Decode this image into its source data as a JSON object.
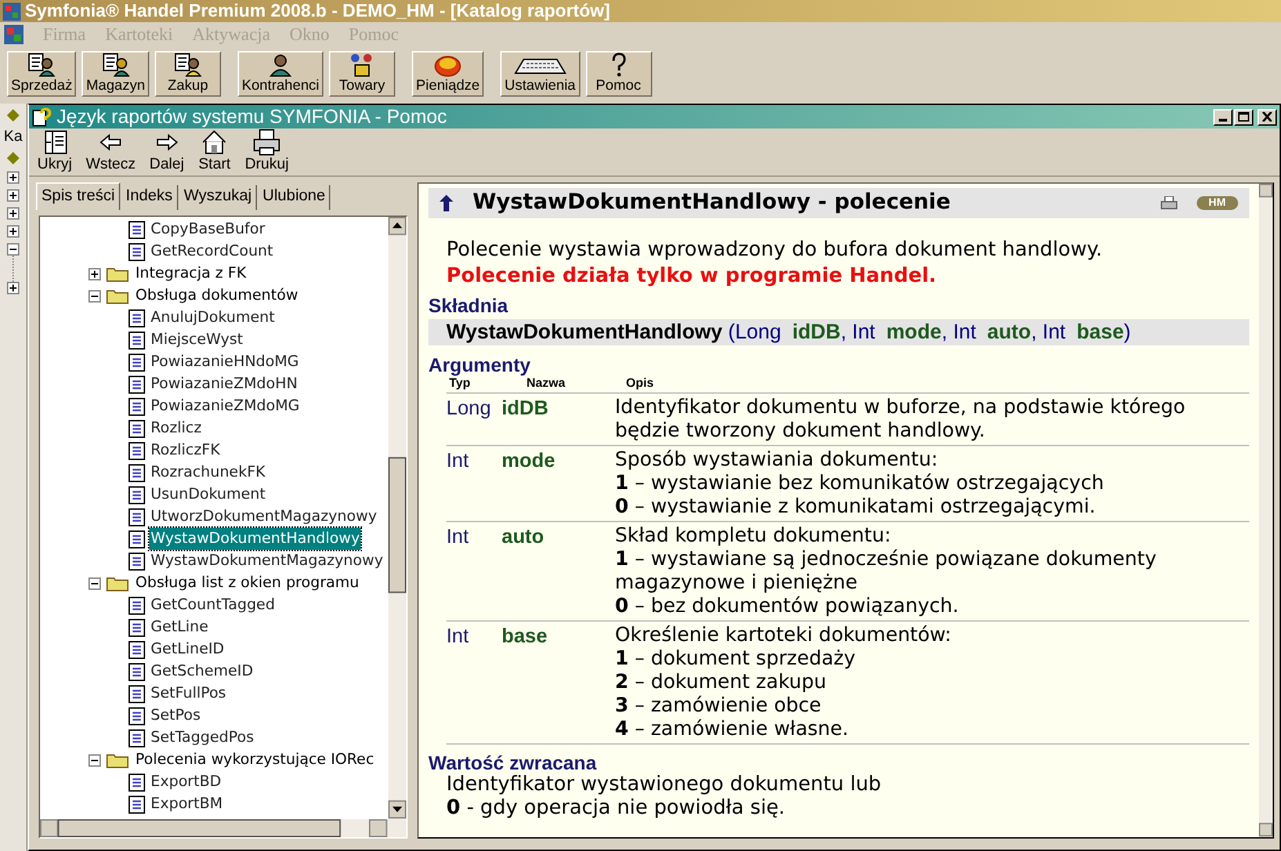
{
  "app": {
    "title": "Symfonia® Handel Premium 2008.b - DEMO_HM - [Katalog raportów]",
    "menu": [
      {
        "label": "Firma",
        "disabled": true
      },
      {
        "label": "Kartoteki",
        "disabled": true
      },
      {
        "label": "Aktywacja",
        "disabled": true
      },
      {
        "label": "Okno",
        "disabled": true
      },
      {
        "label": "Pomoc",
        "disabled": true
      }
    ],
    "toolbar": [
      [
        {
          "label": "Sprzedaż",
          "kind": "sale"
        },
        {
          "label": "Magazyn",
          "kind": "stock"
        },
        {
          "label": "Zakup",
          "kind": "purchase"
        }
      ],
      [
        {
          "label": "Kontrahenci",
          "kind": "person"
        },
        {
          "label": "Towary",
          "kind": "goods"
        }
      ],
      [
        {
          "label": "Pieniądze",
          "kind": "money"
        }
      ],
      [
        {
          "label": "Ustawienia",
          "kind": "keyboard"
        },
        {
          "label": "Pomoc",
          "kind": "help"
        }
      ]
    ],
    "side_label": "Ka"
  },
  "help_window": {
    "title": "Język raportów systemu SYMFONIA - Pomoc",
    "toolbar": [
      {
        "label": "Ukryj",
        "kind": "hide"
      },
      {
        "label": "Wstecz",
        "kind": "back"
      },
      {
        "label": "Dalej",
        "kind": "forward"
      },
      {
        "label": "Start",
        "kind": "home"
      },
      {
        "label": "Drukuj",
        "kind": "print"
      }
    ],
    "tabs": [
      {
        "label": "Spis treści",
        "selected": true
      },
      {
        "label": "Indeks",
        "selected": false
      },
      {
        "label": "Wyszukaj",
        "selected": false
      },
      {
        "label": "Ulubione",
        "selected": false
      }
    ],
    "tree": [
      {
        "label": "CopyBaseBufor",
        "kind": "page",
        "selected": false
      },
      {
        "label": "GetRecordCount",
        "kind": "page",
        "selected": false
      },
      {
        "label": "Integracja z FK",
        "kind": "folder",
        "expanded": false,
        "selected": false
      },
      {
        "label": "Obsługa dokumentów",
        "kind": "folder",
        "expanded": true,
        "selected": false,
        "children": [
          {
            "label": "AnulujDokument",
            "kind": "page",
            "selected": false
          },
          {
            "label": "MiejsceWyst",
            "kind": "page",
            "selected": false
          },
          {
            "label": "PowiazanieHNdoMG",
            "kind": "page",
            "selected": false
          },
          {
            "label": "PowiazanieZMdoHN",
            "kind": "page",
            "selected": false
          },
          {
            "label": "PowiazanieZMdoMG",
            "kind": "page",
            "selected": false
          },
          {
            "label": "Rozlicz",
            "kind": "page",
            "selected": false
          },
          {
            "label": "RozliczFK",
            "kind": "page",
            "selected": false
          },
          {
            "label": "RozrachunekFK",
            "kind": "page",
            "selected": false
          },
          {
            "label": "UsunDokument",
            "kind": "page",
            "selected": false
          },
          {
            "label": "UtworzDokumentMagazynowy",
            "kind": "page",
            "selected": false
          },
          {
            "label": "WystawDokumentHandlowy",
            "kind": "page",
            "selected": true
          },
          {
            "label": "WystawDokumentMagazynowy",
            "kind": "page",
            "selected": false
          }
        ]
      },
      {
        "label": "Obsługa list z okien programu",
        "kind": "folder",
        "expanded": true,
        "selected": false,
        "children": [
          {
            "label": "GetCountTagged",
            "kind": "page",
            "selected": false
          },
          {
            "label": "GetLine",
            "kind": "page",
            "selected": false
          },
          {
            "label": "GetLineID",
            "kind": "page",
            "selected": false
          },
          {
            "label": "GetSchemeID",
            "kind": "page",
            "selected": false
          },
          {
            "label": "SetFullPos",
            "kind": "page",
            "selected": false
          },
          {
            "label": "SetPos",
            "kind": "page",
            "selected": false
          },
          {
            "label": "SetTaggedPos",
            "kind": "page",
            "selected": false
          }
        ]
      },
      {
        "label": "Polecenia wykorzystujące IORec",
        "kind": "folder",
        "expanded": true,
        "selected": false,
        "children": [
          {
            "label": "ExportBD",
            "kind": "page",
            "selected": false
          },
          {
            "label": "ExportBM",
            "kind": "page",
            "selected": false
          }
        ]
      }
    ],
    "topic": {
      "title": "WystawDokumentHandlowy - polecenie",
      "badge": "HM",
      "intro": "Polecenie wystawia wprowadzony do bufora dokument handlowy.",
      "warning": "Polecenie działa tylko w programie Handel.",
      "syntax_heading": "Składnia",
      "syntax": [
        {
          "kind": "function",
          "text": "WystawDokumentHandlowy"
        },
        {
          "kind": "punct",
          "text": " ("
        },
        {
          "kind": "type",
          "text": "Long"
        },
        {
          "kind": "name",
          "text": "idDB"
        },
        {
          "kind": "punct",
          "text": ", "
        },
        {
          "kind": "type",
          "text": "Int"
        },
        {
          "kind": "name",
          "text": "mode"
        },
        {
          "kind": "punct",
          "text": ", "
        },
        {
          "kind": "type",
          "text": "Int"
        },
        {
          "kind": "name",
          "text": "auto"
        },
        {
          "kind": "punct",
          "text": ", "
        },
        {
          "kind": "type",
          "text": "Int"
        },
        {
          "kind": "name",
          "text": "base"
        },
        {
          "kind": "punct",
          "text": ")"
        }
      ],
      "arguments_heading": "Argumenty",
      "columns": [
        "Typ",
        "Nazwa",
        "Opis"
      ],
      "arguments": [
        {
          "type": "Long",
          "name": "idDB",
          "description": [
            "Identyfikator dokumentu w buforze, na podstawie którego będzie tworzony dokument handlowy."
          ]
        },
        {
          "type": "Int",
          "name": "mode",
          "description": [
            "Sposób wystawiania dokumentu:",
            "**1** – wystawianie bez komunikatów ostrzegających",
            "**0** – wystawianie z komunikatami ostrzegającymi."
          ]
        },
        {
          "type": "Int",
          "name": "auto",
          "description": [
            "Skład kompletu dokumentu:",
            "**1** – wystawiane są jednocześnie powiązane dokumenty magazynowe i pieniężne",
            "**0** – bez dokumentów powiązanych."
          ]
        },
        {
          "type": "Int",
          "name": "base",
          "description": [
            "Określenie kartoteki dokumentów:",
            "**1** – dokument sprzedaży",
            "**2** – dokument zakupu",
            "**3** – zamówienie obce",
            "**4** – zamówienie własne."
          ]
        }
      ],
      "return_heading": "Wartość zwracana",
      "return": [
        "Identyfikator wystawionego dokumentu lub",
        "**0** - gdy operacja nie powiodła się."
      ]
    }
  }
}
